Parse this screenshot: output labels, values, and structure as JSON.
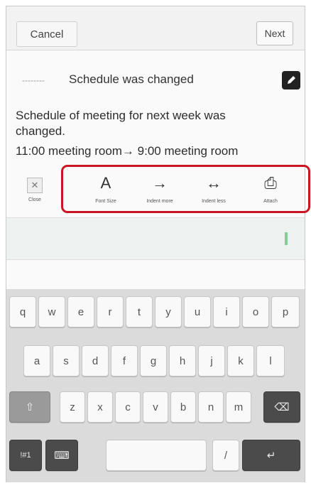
{
  "header": {
    "cancel_label": "Cancel",
    "next_label": "Next"
  },
  "message": {
    "subject_prefix": "--------",
    "subject": "Schedule was changed",
    "body_line1": "Schedule of meeting for next week was",
    "body_line2": "changed.",
    "body_line3": "11:00 meeting room→ 9:00 meeting room"
  },
  "toolbar": {
    "close": {
      "icon": "x-icon",
      "glyph": "✕",
      "label": "Close"
    },
    "items": [
      {
        "icon": "text-size-icon",
        "glyph": "A",
        "label": "Font Size"
      },
      {
        "icon": "indent-icon",
        "glyph": "→",
        "label": "Indent more"
      },
      {
        "icon": "outdent-icon",
        "glyph": "↔",
        "label": "Indent less"
      },
      {
        "icon": "attach-icon",
        "glyph": "⎙",
        "label": "Attach"
      }
    ],
    "highlight_color": "#cc1522"
  },
  "keyboard": {
    "row1": [
      "q",
      "w",
      "e",
      "r",
      "t",
      "y",
      "u",
      "i",
      "o",
      "p"
    ],
    "row2": [
      "a",
      "s",
      "d",
      "f",
      "g",
      "h",
      "j",
      "k",
      "l"
    ],
    "row3": [
      "z",
      "x",
      "c",
      "v",
      "b",
      "n",
      "m"
    ],
    "shift_icon": "shift-icon",
    "shift_glyph": "⇧",
    "backspace_icon": "backspace-icon",
    "backspace_glyph": "⌫",
    "symbols_label": "!#1",
    "settings_icon": "keyboard-settings-icon",
    "settings_glyph": "⌨",
    "period_label": "/",
    "enter_icon": "enter-icon",
    "enter_glyph": "↵"
  }
}
